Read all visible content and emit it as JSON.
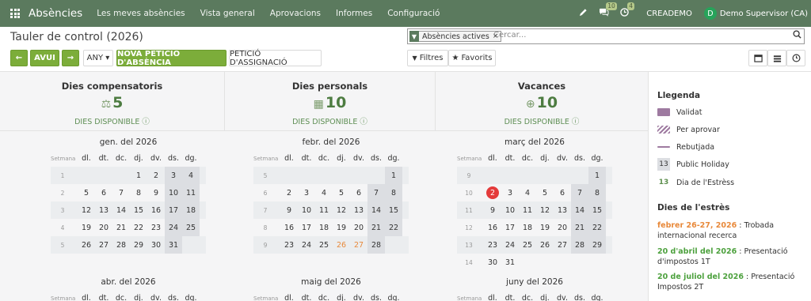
{
  "navbar": {
    "app_name": "Absències",
    "menu": [
      "Les meves absències",
      "Vista general",
      "Aprovacions",
      "Informes",
      "Configuració"
    ],
    "messages_count": "10",
    "activities_count": "4",
    "company": "CREADEMO",
    "user_initial": "D",
    "user_name": "Demo Supervisor (CA)",
    "brand_color": "#5b7a5e",
    "icons": [
      "apps-grid-icon",
      "pencil-icon",
      "chat-icon",
      "clock-icon"
    ]
  },
  "control_panel": {
    "title": "Tauler de control (2026)",
    "prev_label": "←",
    "today_label": "AVUI",
    "next_label": "→",
    "year_label": "ANY ▾",
    "new_request_label": "NOVA PETICIÓ D'ABSÈNCIA",
    "allocation_label": "PETICIÓ D'ASSIGNACIÓ",
    "search_facet": "Absències actives",
    "search_placeholder": "Cercar...",
    "filters_label": "Filtres",
    "favorites_label": "Favorits",
    "views": [
      "calendar-view-icon",
      "list-view-icon",
      "activity-view-icon"
    ]
  },
  "stats": [
    {
      "title": "Dies compensatoris",
      "value": "5",
      "icon": "scale-icon",
      "label": "DIES DISPONIBLE"
    },
    {
      "title": "Dies personals",
      "value": "10",
      "icon": "calendar-365-icon",
      "label": "DIES DISPONIBLE"
    },
    {
      "title": "Vacances",
      "value": "10",
      "icon": "umbrella-globe-icon",
      "label": "DIES DISPONIBLE"
    }
  ],
  "weekday_header": {
    "week": "Setmana",
    "days": [
      "dl.",
      "dt.",
      "dc.",
      "dj.",
      "dv.",
      "ds.",
      "dg."
    ]
  },
  "months": [
    {
      "title": "gen. del 2026",
      "weeks": [
        {
          "w": "1",
          "days": [
            "",
            "",
            "",
            "1",
            "2",
            "3",
            "4"
          ]
        },
        {
          "w": "2",
          "days": [
            "5",
            "6",
            "7",
            "8",
            "9",
            "10",
            "11"
          ]
        },
        {
          "w": "3",
          "days": [
            "12",
            "13",
            "14",
            "15",
            "16",
            "17",
            "18"
          ]
        },
        {
          "w": "4",
          "days": [
            "19",
            "20",
            "21",
            "22",
            "23",
            "24",
            "25"
          ]
        },
        {
          "w": "5",
          "days": [
            "26",
            "27",
            "28",
            "29",
            "30",
            "31",
            ""
          ]
        }
      ]
    },
    {
      "title": "febr. del 2026",
      "weeks": [
        {
          "w": "5",
          "days": [
            "",
            "",
            "",
            "",
            "",
            "",
            "1"
          ]
        },
        {
          "w": "6",
          "days": [
            "2",
            "3",
            "4",
            "5",
            "6",
            "7",
            "8"
          ]
        },
        {
          "w": "7",
          "days": [
            "9",
            "10",
            "11",
            "12",
            "13",
            "14",
            "15"
          ]
        },
        {
          "w": "8",
          "days": [
            "16",
            "17",
            "18",
            "19",
            "20",
            "21",
            "22"
          ]
        },
        {
          "w": "9",
          "days": [
            "23",
            "24",
            "25",
            "26",
            "27",
            "28",
            ""
          ]
        }
      ]
    },
    {
      "title": "març del 2026",
      "weeks": [
        {
          "w": "9",
          "days": [
            "",
            "",
            "",
            "",
            "",
            "",
            "1"
          ]
        },
        {
          "w": "10",
          "days": [
            "2",
            "3",
            "4",
            "5",
            "6",
            "7",
            "8"
          ]
        },
        {
          "w": "11",
          "days": [
            "9",
            "10",
            "11",
            "12",
            "13",
            "14",
            "15"
          ]
        },
        {
          "w": "12",
          "days": [
            "16",
            "17",
            "18",
            "19",
            "20",
            "21",
            "22"
          ]
        },
        {
          "w": "13",
          "days": [
            "23",
            "24",
            "25",
            "26",
            "27",
            "28",
            "29"
          ]
        },
        {
          "w": "14",
          "days": [
            "30",
            "31",
            "",
            "",
            "",
            "",
            ""
          ]
        }
      ]
    },
    {
      "title": "abr. del 2026",
      "weeks": []
    },
    {
      "title": "maig del 2026",
      "weeks": []
    },
    {
      "title": "juny del 2026",
      "weeks": []
    }
  ],
  "sidebar": {
    "legend_title": "Llegenda",
    "legend": [
      {
        "label": "Validat"
      },
      {
        "label": "Per aprovar"
      },
      {
        "label": "Rebutjada"
      },
      {
        "label": "Public Holiday",
        "sample": "13"
      },
      {
        "label": "Dia de l'Estrèss",
        "sample": "13"
      }
    ],
    "stress_title": "Dies de l'estrès",
    "stress_days": [
      {
        "date": "febrer 26-27, 2026",
        "text": " : Trobada internacional recerca",
        "color": "#e8893a"
      },
      {
        "date": "20 d'abril del 2026",
        "text": " : Presentació d'impostos 1T",
        "color": "#4da13e"
      },
      {
        "date": "20 de juliol del 2026",
        "text": " : Presentació Impostos 2T",
        "color": "#4da13e"
      }
    ]
  }
}
